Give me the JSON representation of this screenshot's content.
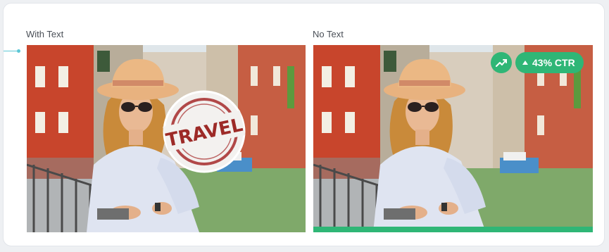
{
  "panels": {
    "with_text": {
      "label": "With Text",
      "stamp_text": "TRAVEL"
    },
    "no_text": {
      "label": "No Text",
      "ctr_value": "43% CTR"
    }
  },
  "colors": {
    "accent_green": "#2fb676",
    "connector_teal": "#5cc7d6"
  },
  "icons": {
    "trend": "trending-up-icon",
    "ctr_arrow": "caret-up-icon"
  }
}
